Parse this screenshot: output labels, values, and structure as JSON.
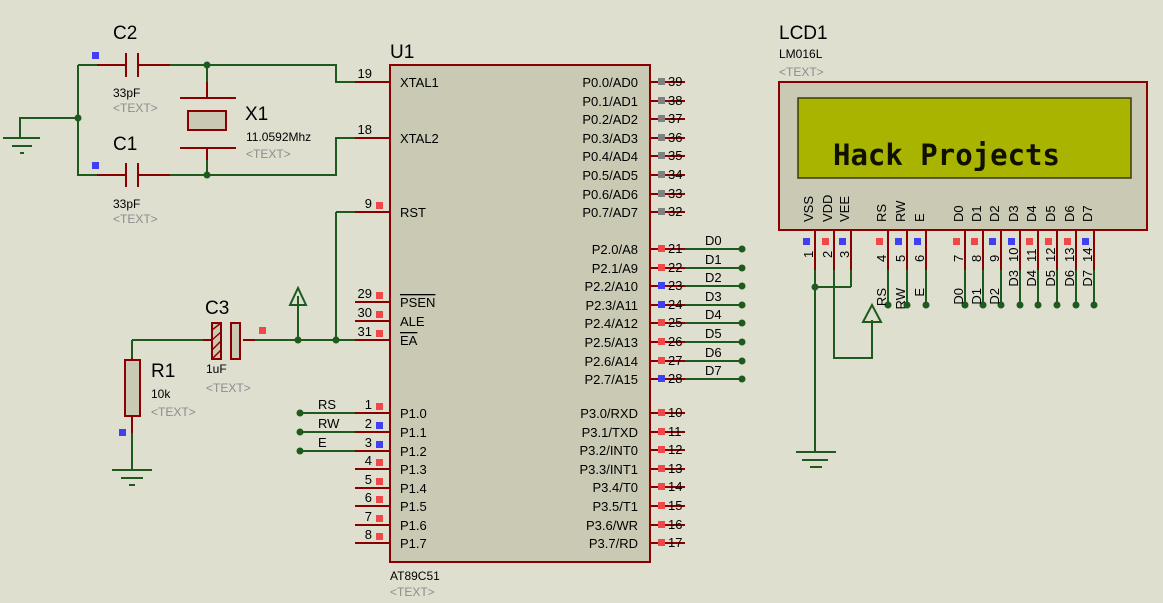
{
  "colors": {
    "background": "#dfdfd0",
    "wire": "#1e5a1e",
    "pin": "#8a0000",
    "chip_fill": "#c9c9b4",
    "lcd_screen": "#a8b400",
    "pin_red": "#f04848",
    "pin_blue": "#4040f0",
    "pin_grey": "#808080"
  },
  "c2": {
    "ref": "C2",
    "value": "33pF",
    "text": "<TEXT>"
  },
  "c1": {
    "ref": "C1",
    "value": "33pF",
    "text": "<TEXT>"
  },
  "x1": {
    "ref": "X1",
    "value": "11.0592Mhz",
    "text": "<TEXT>"
  },
  "c3": {
    "ref": "C3",
    "value": "1uF",
    "text": "<TEXT>"
  },
  "r1": {
    "ref": "R1",
    "value": "10k",
    "text": "<TEXT>"
  },
  "u1": {
    "ref": "U1",
    "part": "AT89C51",
    "text": "<TEXT>",
    "left_pins": [
      {
        "num": "19",
        "name": "XTAL1",
        "state": "none"
      },
      {
        "num": "18",
        "name": "XTAL2",
        "state": "none"
      },
      {
        "num": "9",
        "name": "RST",
        "state": "red"
      },
      {
        "num": "29",
        "name": "PSEN",
        "state": "red",
        "overline": true
      },
      {
        "num": "30",
        "name": "ALE",
        "state": "red"
      },
      {
        "num": "31",
        "name": "EA",
        "state": "red",
        "overline": true
      },
      {
        "num": "1",
        "name": "P1.0",
        "state": "red",
        "net": "RS"
      },
      {
        "num": "2",
        "name": "P1.1",
        "state": "blue",
        "net": "RW"
      },
      {
        "num": "3",
        "name": "P1.2",
        "state": "blue",
        "net": "E"
      },
      {
        "num": "4",
        "name": "P1.3",
        "state": "red"
      },
      {
        "num": "5",
        "name": "P1.4",
        "state": "red"
      },
      {
        "num": "6",
        "name": "P1.5",
        "state": "red"
      },
      {
        "num": "7",
        "name": "P1.6",
        "state": "red"
      },
      {
        "num": "8",
        "name": "P1.7",
        "state": "red"
      }
    ],
    "right_pins": [
      {
        "num": "39",
        "name": "P0.0/AD0",
        "state": "grey"
      },
      {
        "num": "38",
        "name": "P0.1/AD1",
        "state": "grey"
      },
      {
        "num": "37",
        "name": "P0.2/AD2",
        "state": "grey"
      },
      {
        "num": "36",
        "name": "P0.3/AD3",
        "state": "grey"
      },
      {
        "num": "35",
        "name": "P0.4/AD4",
        "state": "grey"
      },
      {
        "num": "34",
        "name": "P0.5/AD5",
        "state": "grey"
      },
      {
        "num": "33",
        "name": "P0.6/AD6",
        "state": "grey"
      },
      {
        "num": "32",
        "name": "P0.7/AD7",
        "state": "grey"
      },
      {
        "num": "21",
        "name": "P2.0/A8",
        "state": "red",
        "net": "D0"
      },
      {
        "num": "22",
        "name": "P2.1/A9",
        "state": "red",
        "net": "D1"
      },
      {
        "num": "23",
        "name": "P2.2/A10",
        "state": "blue",
        "net": "D2"
      },
      {
        "num": "24",
        "name": "P2.3/A11",
        "state": "blue",
        "net": "D3"
      },
      {
        "num": "25",
        "name": "P2.4/A12",
        "state": "red",
        "net": "D4"
      },
      {
        "num": "26",
        "name": "P2.5/A13",
        "state": "red",
        "net": "D5"
      },
      {
        "num": "27",
        "name": "P2.6/A14",
        "state": "red",
        "net": "D6"
      },
      {
        "num": "28",
        "name": "P2.7/A15",
        "state": "blue",
        "net": "D7"
      },
      {
        "num": "10",
        "name": "P3.0/RXD",
        "state": "red"
      },
      {
        "num": "11",
        "name": "P3.1/TXD",
        "state": "red"
      },
      {
        "num": "12",
        "name": "P3.2/INT0",
        "state": "red"
      },
      {
        "num": "13",
        "name": "P3.3/INT1",
        "state": "red"
      },
      {
        "num": "14",
        "name": "P3.4/T0",
        "state": "red"
      },
      {
        "num": "15",
        "name": "P3.5/T1",
        "state": "red"
      },
      {
        "num": "16",
        "name": "P3.6/WR",
        "state": "red"
      },
      {
        "num": "17",
        "name": "P3.7/RD",
        "state": "red"
      }
    ]
  },
  "lcd": {
    "ref": "LCD1",
    "part": "LM016L",
    "text": "<TEXT>",
    "display": "Hack Projects",
    "pins": [
      {
        "num": "1",
        "name": "VSS",
        "state": "blue"
      },
      {
        "num": "2",
        "name": "VDD",
        "state": "red"
      },
      {
        "num": "3",
        "name": "VEE",
        "state": "blue"
      },
      {
        "num": "4",
        "name": "RS",
        "state": "red",
        "net": "RS"
      },
      {
        "num": "5",
        "name": "RW",
        "state": "blue",
        "net": "RW"
      },
      {
        "num": "6",
        "name": "E",
        "state": "blue",
        "net": "E"
      },
      {
        "num": "7",
        "name": "D0",
        "state": "red",
        "net": "D0"
      },
      {
        "num": "8",
        "name": "D1",
        "state": "red",
        "net": "D1"
      },
      {
        "num": "9",
        "name": "D2",
        "state": "blue",
        "net": "D2"
      },
      {
        "num": "10",
        "name": "D3",
        "state": "blue",
        "net": "D3"
      },
      {
        "num": "11",
        "name": "D4",
        "state": "red",
        "net": "D4"
      },
      {
        "num": "12",
        "name": "D5",
        "state": "red",
        "net": "D5"
      },
      {
        "num": "13",
        "name": "D6",
        "state": "red",
        "net": "D6"
      },
      {
        "num": "14",
        "name": "D7",
        "state": "blue",
        "net": "D7"
      }
    ]
  }
}
